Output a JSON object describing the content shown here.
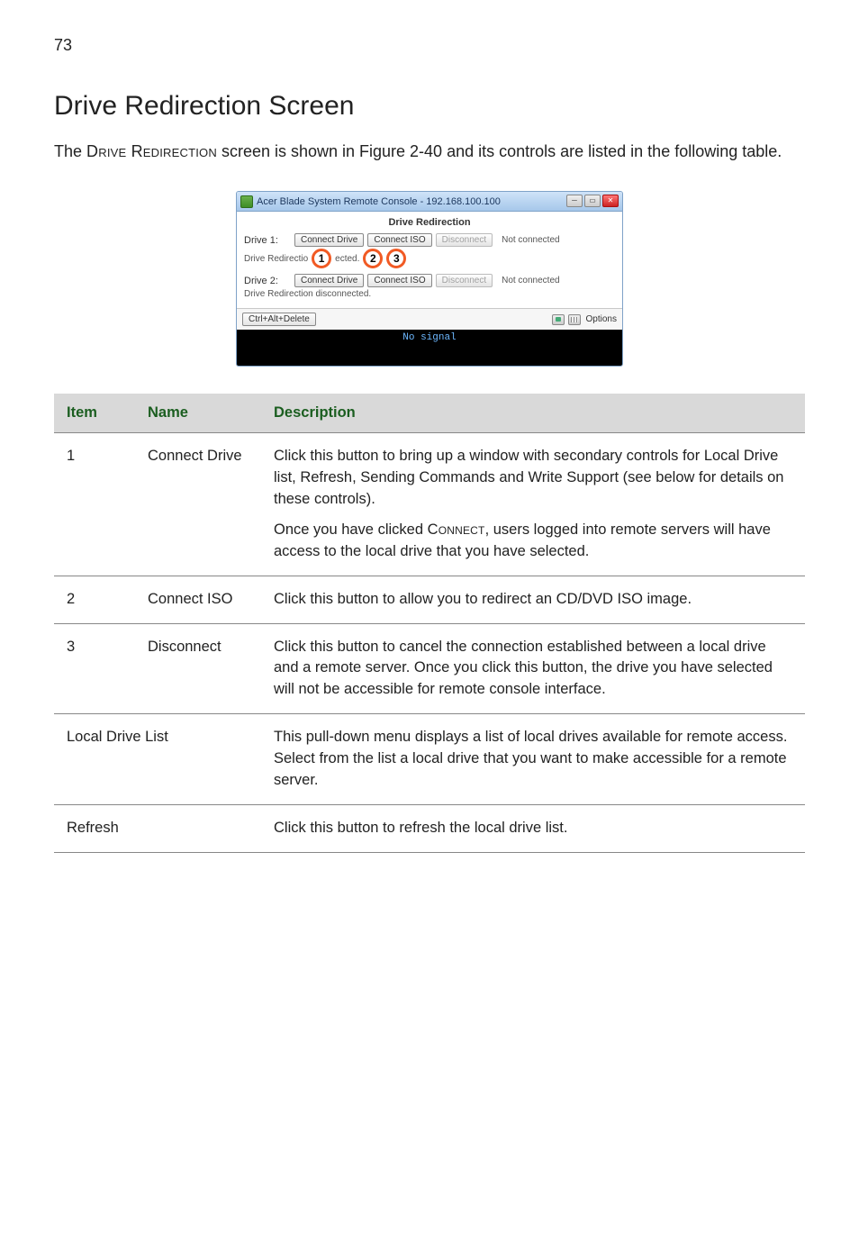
{
  "page_number": "73",
  "heading": "Drive Redirection Screen",
  "intro_pre": "The ",
  "intro_sc1": "Drive Redirection",
  "intro_mid": " screen is shown in Figure 2-40 and its controls are listed in the following table.",
  "window": {
    "title": "Acer Blade System Remote Console - 192.168.100.100",
    "panel_title": "Drive Redirection",
    "drive1_label": "Drive 1:",
    "drive2_label": "Drive 2:",
    "btn_connect_drive": "Connect Drive",
    "btn_connect_iso": "Connect ISO",
    "btn_disconnect": "Disconnect",
    "not_connected": "Not connected",
    "sub_status_prefix": "Drive Redirectio",
    "sub_status_suffix": "ected.",
    "sub_status_line2": "Drive Redirection disconnected.",
    "cad": "Ctrl+Alt+Delete",
    "options": "Options",
    "no_signal": "No signal",
    "num1": "1",
    "num2": "2",
    "num3": "3"
  },
  "table": {
    "headers": {
      "item": "Item",
      "name": "Name",
      "desc": "Description"
    },
    "rows": [
      {
        "item": "1",
        "name": "Connect Drive",
        "desc_p1_pre": "Click this button to bring up a window with secondary controls for Local Drive list, Refresh, Sending Commands and Write Support (see below for details on these controls).",
        "desc_p2_pre": "Once you have clicked ",
        "desc_p2_sc": "Connect",
        "desc_p2_post": ", users logged into remote servers will have access to the local drive that you have selected."
      },
      {
        "item": "2",
        "name": "Connect ISO",
        "desc_p1_pre": "Click this button to allow you to redirect an CD/DVD ISO image."
      },
      {
        "item": "3",
        "name": "Disconnect",
        "desc_p1_pre": "Click this button to cancel the connection established between a local drive and a remote server. Once you click this button, the drive you have selected will not be accessible for remote console interface."
      },
      {
        "item_name_merged": "Local Drive List",
        "desc_p1_pre": "This pull-down menu displays a list of local drives available for remote access. Select from the list a local drive that you want to make accessible for a remote server."
      },
      {
        "item_name_merged": "Refresh",
        "desc_p1_pre": "Click this button to refresh the local drive list."
      }
    ]
  }
}
